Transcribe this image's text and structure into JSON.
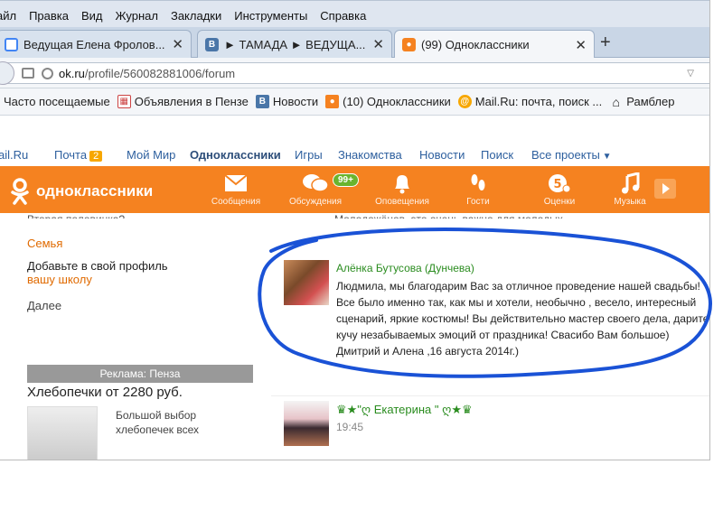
{
  "menu": [
    "айл",
    "Правка",
    "Вид",
    "Журнал",
    "Закладки",
    "Инструменты",
    "Справка"
  ],
  "tabs": [
    {
      "label": "Ведущая Елена Фролов...",
      "icon": "google-icon"
    },
    {
      "label": "► ТАМАДА ► ВЕДУЩА...",
      "icon": "vk-icon",
      "fav": "B"
    },
    {
      "label": "(99) Одноклассники",
      "icon": "ok-icon",
      "fav": "ok"
    }
  ],
  "new_tab": "+",
  "address": {
    "host": "ok.ru",
    "path": "/profile/560082881006/forum"
  },
  "bookmarks": [
    {
      "label": "Часто посещаемые",
      "icon": "none"
    },
    {
      "label": "Объявления в Пензе",
      "icon": "calendar-icon"
    },
    {
      "label": "Новости",
      "icon": "vk-icon",
      "fav": "B"
    },
    {
      "label": "(10) Одноклассники",
      "icon": "ok-icon",
      "fav": "ok"
    },
    {
      "label": "Mail.Ru: почта, поиск ...",
      "icon": "mailru-icon",
      "fav": "@"
    },
    {
      "label": "Рамблер",
      "icon": "home-icon",
      "fav": "⌂"
    }
  ],
  "ok_links": {
    "mailru": "ail.Ru",
    "pochta": "Почта",
    "pochta_count": "2",
    "moy_mir": "Мой Мир",
    "odnoklassniki": "Одноклассники",
    "igry": "Игры",
    "znakomstva": "Знакомства",
    "novosti": "Новости",
    "poisk": "Поиск",
    "vse": "Все проекты"
  },
  "header": {
    "logo": "одноклассники",
    "nav": [
      "Сообщения",
      "Обсуждения",
      "Оповещения",
      "Гости",
      "Оценки",
      "Музыка"
    ],
    "badge": "99+"
  },
  "cut_left": "Вторая половинка?",
  "cut_right": "Молодожёнов, это очень важно для молодых",
  "left": {
    "family": "Семья",
    "add_profile": "Добавьте в свой профиль",
    "school": "вашу школу",
    "more": "Далее"
  },
  "ad": {
    "head": "Реклама: Пенза",
    "title": "Хлебопечки от 2280 руб.",
    "text": "Большой выбор хлебопечек всех"
  },
  "post1": {
    "author": "Алёнка Бутусова (Дунчева)",
    "text": "Людмила, мы благодарим Вас за отличное проведение нашей свадьбы! Все было именно так, как мы и хотели, необычно , весело, интересный сценарий, яркие костюмы! Вы действительно мастер своего дела, дарите кучу незабываемых эмоций от праздника! Свасибо Вам большое) Дмитрий и Алена ,16 августа 2014г.)"
  },
  "post2": {
    "author": "♛★\"ღ Екатерина \" ღ★♛",
    "time": "19:45"
  }
}
